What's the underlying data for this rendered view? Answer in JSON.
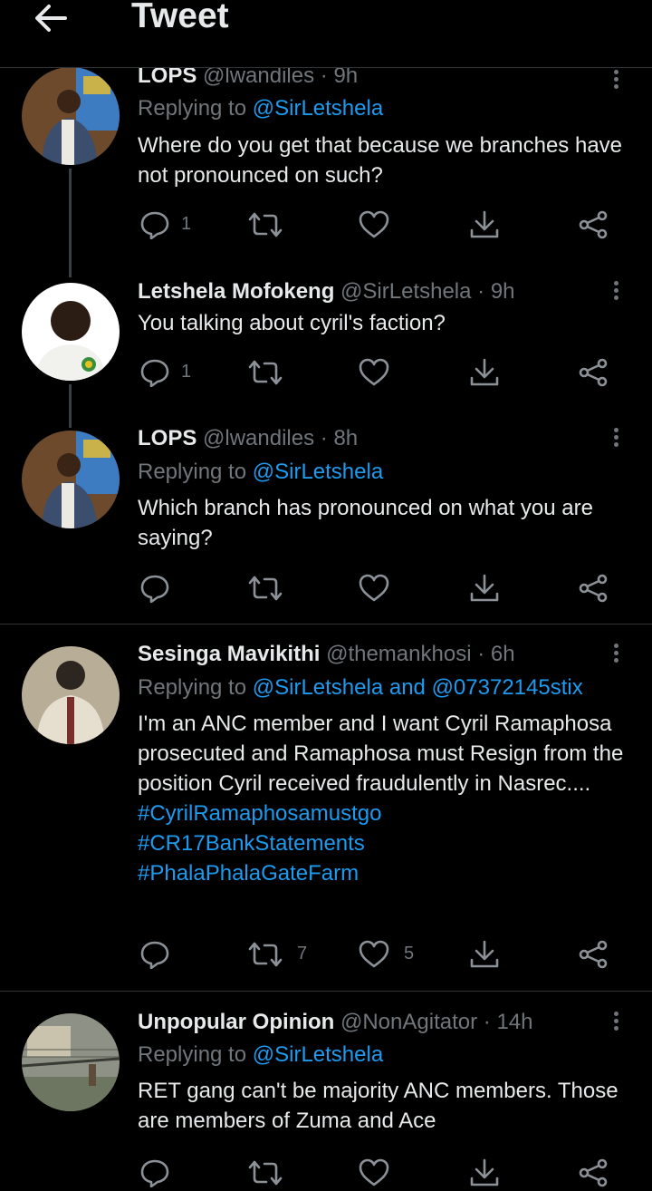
{
  "header": {
    "title": "Tweet"
  },
  "tweets": [
    {
      "name": "LOPS",
      "handle": "@lwandiles",
      "separator": "·",
      "time": "9h",
      "replying_prefix": "Replying to",
      "replying_to": "@SirLetshela",
      "text": "Where do you get that because we branches have not pronounced on such?",
      "reply_count": "1",
      "retweet_count": "",
      "like_count": ""
    },
    {
      "name": "Letshela Mofokeng",
      "handle": "@SirLetshela",
      "separator": "·",
      "time": "9h",
      "text": "You talking about cyril's faction?",
      "reply_count": "1",
      "retweet_count": "",
      "like_count": ""
    },
    {
      "name": "LOPS",
      "handle": "@lwandiles",
      "separator": "·",
      "time": "8h",
      "replying_prefix": "Replying to",
      "replying_to": "@SirLetshela",
      "text": "Which branch has pronounced on what you are saying?",
      "reply_count": "",
      "retweet_count": "",
      "like_count": ""
    },
    {
      "name": "Sesinga Mavikithi",
      "handle": "@themankhosi",
      "separator": "·",
      "time": "6h",
      "replying_prefix": "Replying to",
      "replying_to": "@SirLetshela and @07372145stix",
      "text": "I'm an ANC member and I want Cyril Ramaphosa prosecuted and Ramaphosa must Resign from the position Cyril received fraudulently in Nasrec....",
      "hashtags": [
        "#CyrilRamaphosamustgo",
        "#CR17BankStatements",
        "#PhalaPhalaGateFarm"
      ],
      "reply_count": "",
      "retweet_count": "7",
      "like_count": "5"
    },
    {
      "name": "Unpopular Opinion",
      "handle": "@NonAgitator",
      "separator": "·",
      "time": "14h",
      "replying_prefix": "Replying to",
      "replying_to": "@SirLetshela",
      "text": "RET gang can't be majority ANC members. Those are members of Zuma and Ace"
    }
  ],
  "colors": {
    "background": "#000000",
    "text": "#e7e9ea",
    "muted": "#71767b",
    "accent": "#1d9bf0"
  },
  "icons": [
    "arrow-left-icon",
    "more-icon",
    "reply-icon",
    "retweet-icon",
    "like-icon",
    "download-icon",
    "share-icon"
  ]
}
